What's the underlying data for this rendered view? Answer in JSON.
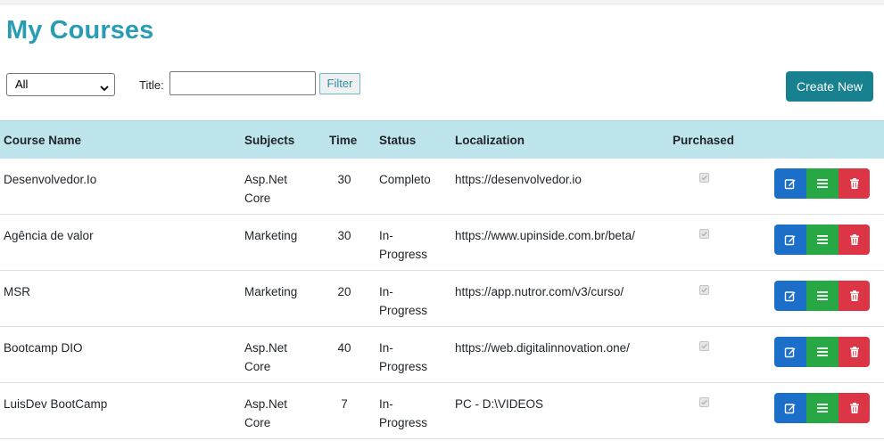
{
  "page": {
    "title": "My Courses"
  },
  "filters": {
    "select_value": "All",
    "title_label": "Title:",
    "title_value": "",
    "filter_label": "Filter"
  },
  "actions": {
    "create_label": "Create New"
  },
  "table": {
    "headers": [
      "Course Name",
      "Subjects",
      "Time",
      "Status",
      "Localization",
      "Purchased"
    ],
    "rows": [
      {
        "name": "Desenvolvedor.Io",
        "subject_l1": "Asp.Net",
        "subject_l2": "Core",
        "time": "30",
        "status_l1": "Completo",
        "status_l2": "",
        "localization": "https://desenvolvedor.io",
        "purchased": true
      },
      {
        "name": "Agência de valor",
        "subject_l1": "Marketing",
        "subject_l2": "",
        "time": "30",
        "status_l1": "In-",
        "status_l2": "Progress",
        "localization": "https://www.upinside.com.br/beta/",
        "purchased": true
      },
      {
        "name": "MSR",
        "subject_l1": "Marketing",
        "subject_l2": "",
        "time": "20",
        "status_l1": "In-",
        "status_l2": "Progress",
        "localization": "https://app.nutror.com/v3/curso/",
        "purchased": true
      },
      {
        "name": "Bootcamp DIO",
        "subject_l1": "Asp.Net",
        "subject_l2": "Core",
        "time": "40",
        "status_l1": "In-",
        "status_l2": "Progress",
        "localization": "https://web.digitalinnovation.one/",
        "purchased": true
      },
      {
        "name": "LuisDev BootCamp",
        "subject_l1": "Asp.Net",
        "subject_l2": "Core",
        "time": "7",
        "status_l1": "In-",
        "status_l2": "Progress",
        "localization": "PC - D:\\VIDEOS",
        "purchased": true
      }
    ]
  },
  "colors": {
    "title": "#2a9db5",
    "header_bg": "#bee5eb",
    "create_btn": "#17818f",
    "edit_btn": "#1c6fc9",
    "details_btn": "#28a745",
    "delete_btn": "#dc3545"
  },
  "icons": {
    "edit": "edit-icon",
    "details": "list-icon",
    "delete": "trash-icon"
  }
}
